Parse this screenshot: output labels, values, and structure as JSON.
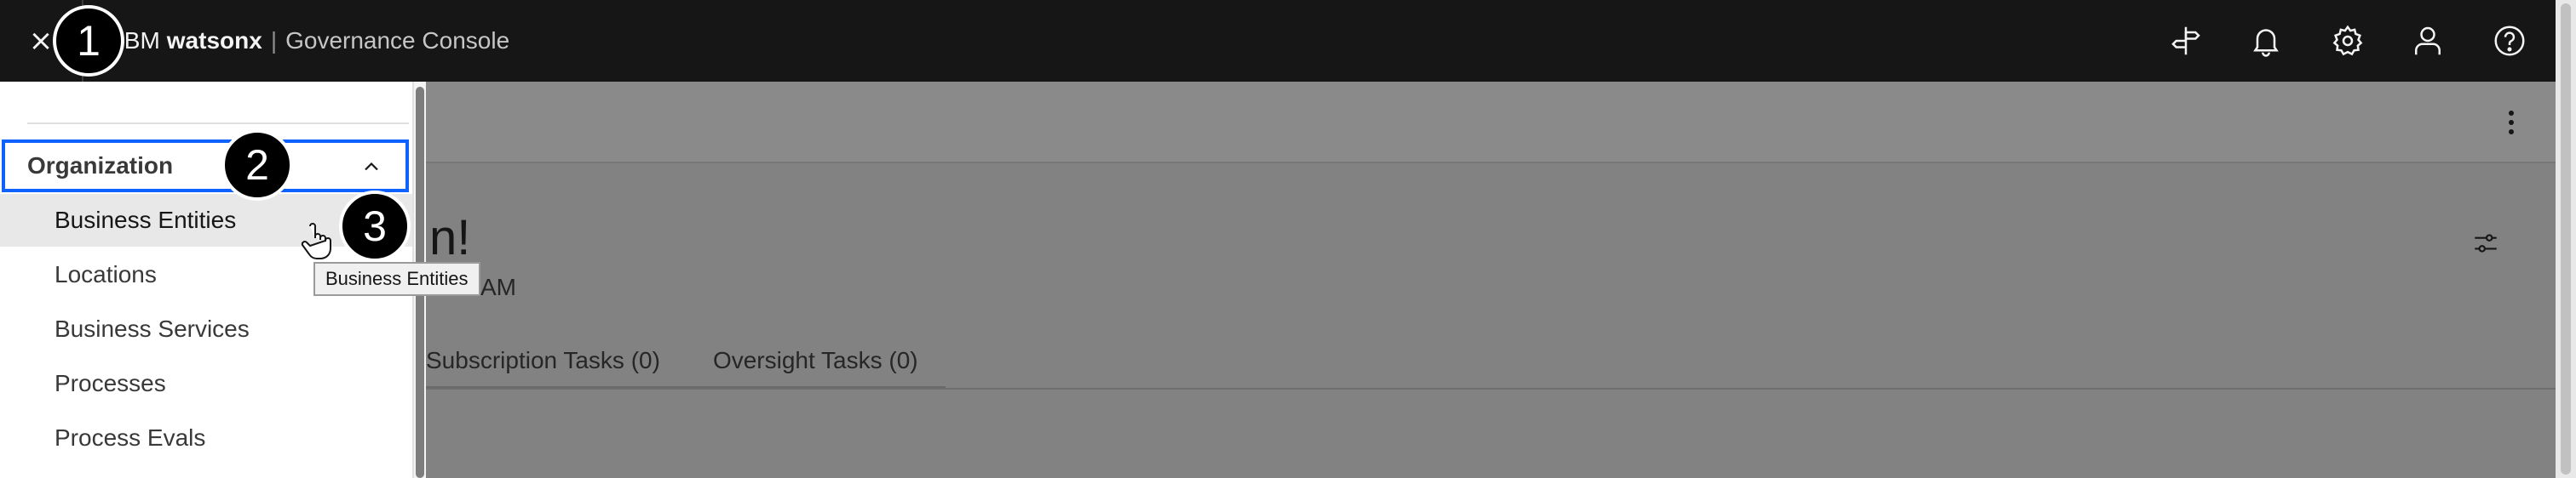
{
  "header": {
    "brand_ibm": "IBM",
    "brand_product": "watsonx",
    "brand_separator": "|",
    "brand_console": "Governance Console",
    "close_glyph": "×",
    "icons": [
      "signpost-icon",
      "notification-icon",
      "settings-icon",
      "user-icon",
      "help-icon"
    ]
  },
  "main": {
    "greeting": "n!",
    "timeline": "AM",
    "tabs": [
      {
        "label": "Subscription Tasks (0)"
      },
      {
        "label": "Oversight Tasks (0)"
      }
    ]
  },
  "sidenav": {
    "section": "Organization",
    "items": [
      {
        "label": "Business Entities"
      },
      {
        "label": "Locations"
      },
      {
        "label": "Business Services"
      },
      {
        "label": "Processes"
      },
      {
        "label": "Process Evals"
      }
    ]
  },
  "tooltip": {
    "text": "Business Entities"
  },
  "badges": [
    "1",
    "2",
    "3"
  ],
  "colors": {
    "header_bg": "#161616",
    "focus_border": "#0f62fe",
    "overlay": "#828282"
  }
}
